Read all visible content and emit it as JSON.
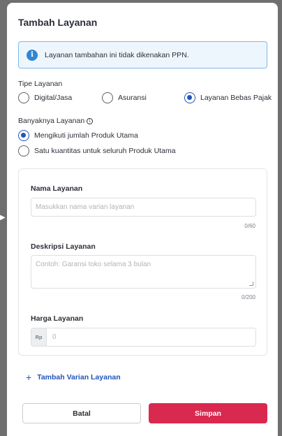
{
  "modal": {
    "title": "Tambah Layanan",
    "info_text": "Layanan tambahan ini tidak dikenakan PPN."
  },
  "service_type": {
    "label": "Tipe Layanan",
    "options": [
      {
        "label": "Digital/Jasa",
        "checked": false
      },
      {
        "label": "Asuransi",
        "checked": false
      },
      {
        "label": "Layanan Bebas Pajak",
        "checked": true
      }
    ]
  },
  "quantity": {
    "label": "Banyaknya Layanan",
    "options": [
      {
        "label": "Mengikuti jumlah Produk Utama",
        "checked": true
      },
      {
        "label": "Satu kuantitas untuk seluruh Produk Utama",
        "checked": false
      }
    ]
  },
  "form": {
    "name_label": "Nama Layanan",
    "name_placeholder": "Masukkan nama varian layanan",
    "name_counter": "0/60",
    "desc_label": "Deskripsi Layanan",
    "desc_placeholder": "Contoh: Garansi toko selama 3 bulan",
    "desc_counter": "0/200",
    "price_label": "Harga Layanan",
    "price_prefix": "Rp",
    "price_value": "0"
  },
  "add_variant_label": "Tambah Varian Layanan",
  "buttons": {
    "cancel": "Batal",
    "save": "Simpan"
  },
  "colors": {
    "accent": "#2056b8",
    "primary_button": "#d9294f",
    "info_bg": "#eef6fd"
  }
}
